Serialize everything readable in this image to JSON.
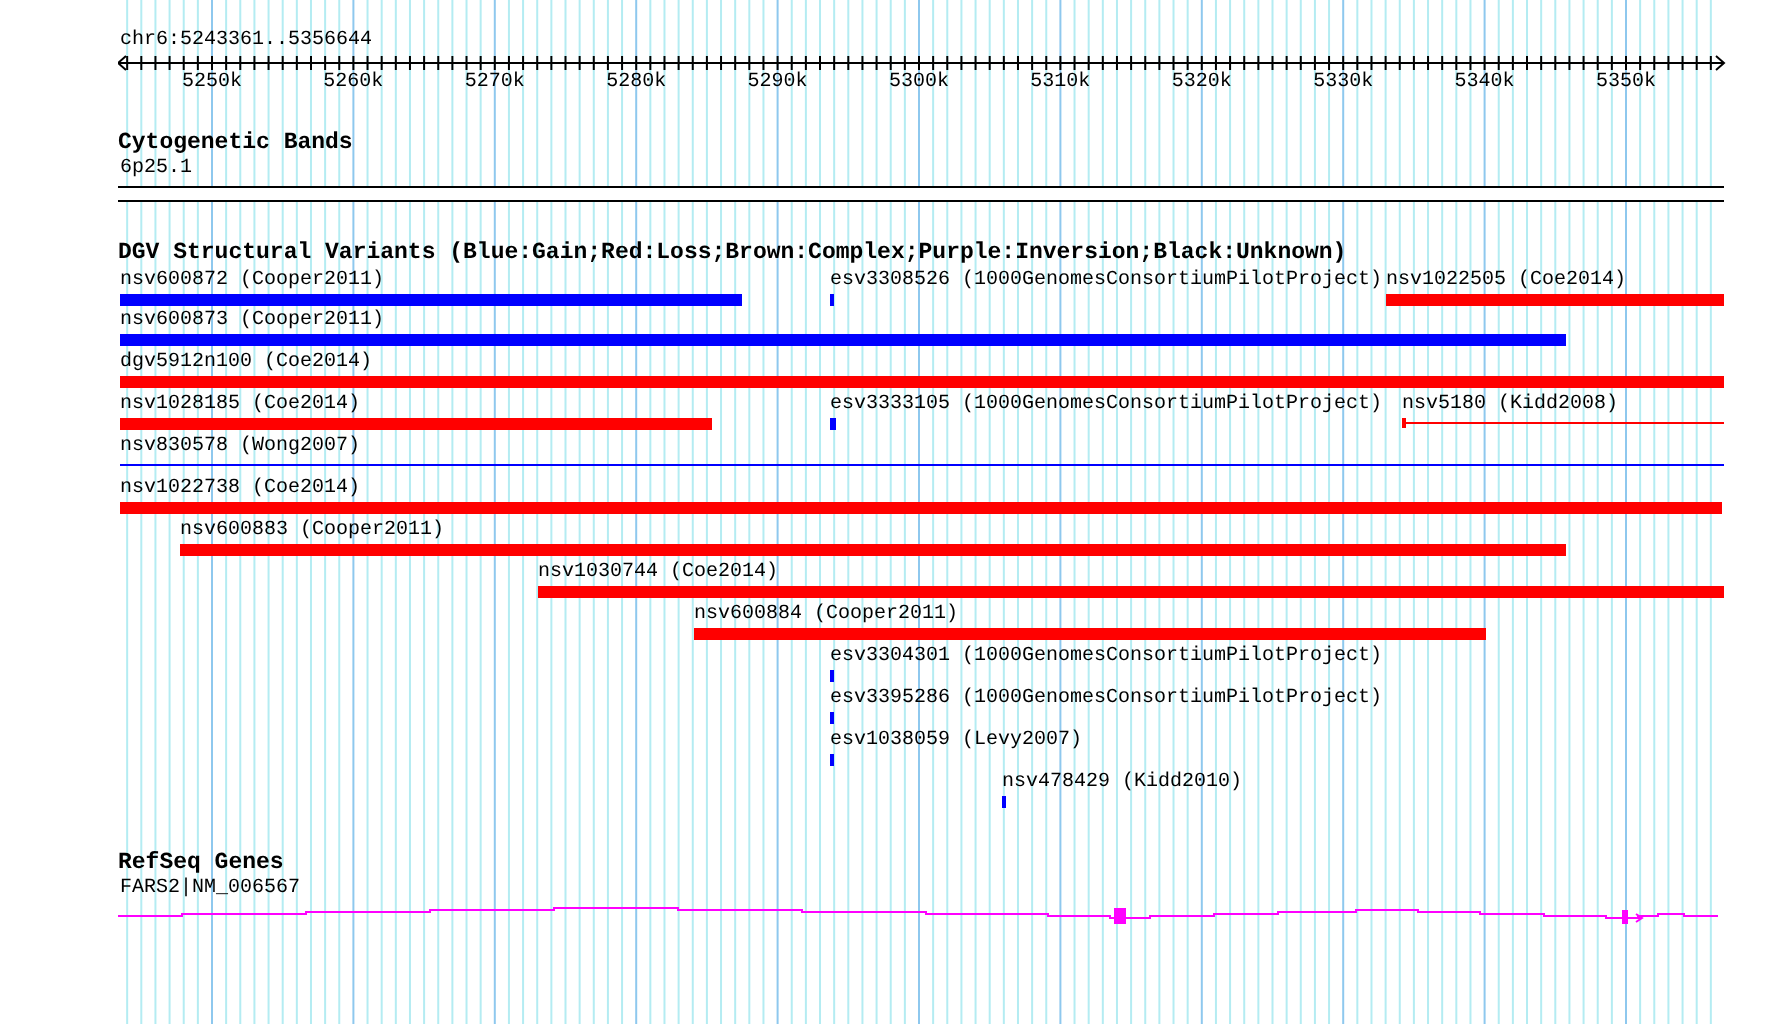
{
  "ruler": {
    "label": "chr6:5243361..5356644",
    "ticks": [
      "5250k",
      "5260k",
      "5270k",
      "5280k",
      "5290k",
      "5300k",
      "5310k",
      "5320k",
      "5330k",
      "5340k",
      "5350k"
    ]
  },
  "tracks": [
    {
      "kind": "bands",
      "title": "Cytogenetic Bands",
      "features": [
        {
          "label": "6p25.1"
        }
      ]
    },
    {
      "kind": "variants",
      "title": "DGV Structural Variants (Blue:Gain;Red:Loss;Brown:Complex;Purple:Inversion;Black:Unknown)",
      "features": [
        {
          "label": "nsv600872 (Cooper2011)",
          "color": "#0000ff",
          "kind": "bar"
        },
        {
          "label": "esv3308526 (1000GenomesConsortiumPilotProject)",
          "color": "#0000ff",
          "kind": "bar"
        },
        {
          "label": "nsv1022505 (Coe2014)",
          "color": "#ff0000",
          "kind": "bar"
        },
        {
          "label": "nsv600873 (Cooper2011)",
          "color": "#0000ff",
          "kind": "bar"
        },
        {
          "label": "dgv5912n100 (Coe2014)",
          "color": "#ff0000",
          "kind": "bar"
        },
        {
          "label": "nsv1028185 (Coe2014)",
          "color": "#ff0000",
          "kind": "bar"
        },
        {
          "label": "esv3333105 (1000GenomesConsortiumPilotProject)",
          "color": "#0000ff",
          "kind": "bar"
        },
        {
          "label": "nsv5180 (Kidd2008)",
          "color": "#ff0000",
          "kind": "line"
        },
        {
          "label": "nsv830578 (Wong2007)",
          "color": "#0000ff",
          "kind": "line"
        },
        {
          "label": "nsv1022738 (Coe2014)",
          "color": "#ff0000",
          "kind": "bar"
        },
        {
          "label": "nsv600883 (Cooper2011)",
          "color": "#ff0000",
          "kind": "bar"
        },
        {
          "label": "nsv1030744 (Coe2014)",
          "color": "#ff0000",
          "kind": "bar"
        },
        {
          "label": "nsv600884 (Cooper2011)",
          "color": "#ff0000",
          "kind": "bar"
        },
        {
          "label": "esv3304301 (1000GenomesConsortiumPilotProject)",
          "color": "#0000ff",
          "kind": "bar"
        },
        {
          "label": "esv3395286 (1000GenomesConsortiumPilotProject)",
          "color": "#0000ff",
          "kind": "bar"
        },
        {
          "label": "esv1038059 (Levy2007)",
          "color": "#0000ff",
          "kind": "bar"
        },
        {
          "label": "nsv478429 (Kidd2010)",
          "color": "#0000ff",
          "kind": "bar"
        }
      ]
    },
    {
      "kind": "genes",
      "title": "RefSeq Genes",
      "features": [
        {
          "label": "FARS2|NM_006567"
        }
      ]
    }
  ]
}
